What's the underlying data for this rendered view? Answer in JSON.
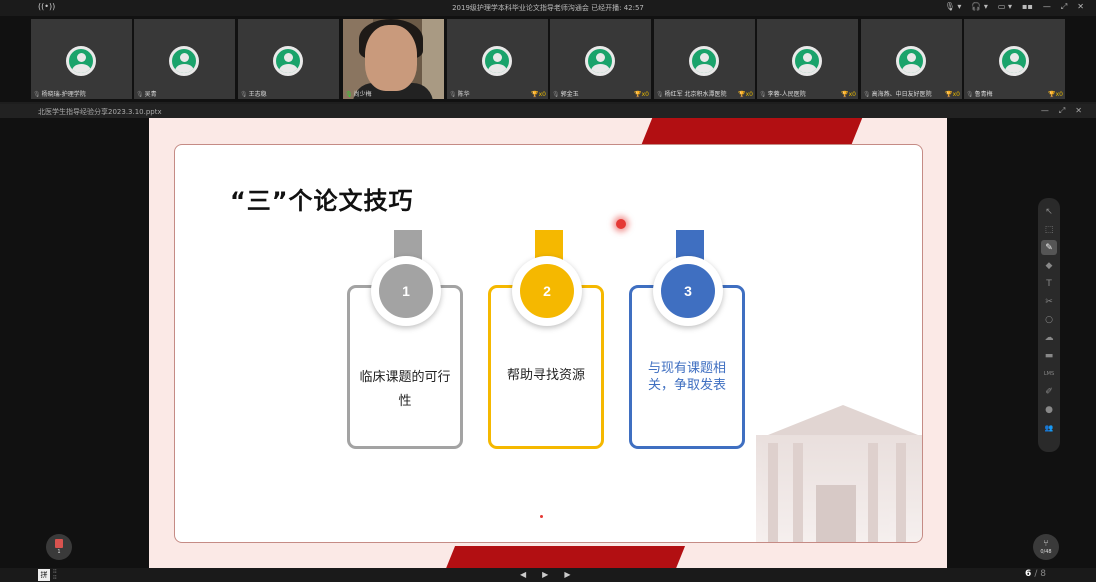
{
  "topbar": {
    "live_icon": "((•))",
    "title": "2019级护理学本科毕业论文指导老师沟通会   已经开播: 42:57",
    "controls": [
      "🎙 ▾",
      "🎧 ▾",
      "▭ ▾",
      "▪▪",
      "—",
      "⤢",
      "✕"
    ]
  },
  "participants": [
    {
      "name": "杨晓瑞-护理学院",
      "trophy": ""
    },
    {
      "name": "吴青",
      "trophy": ""
    },
    {
      "name": "王志稳",
      "trophy": ""
    },
    {
      "name": "尚少梅",
      "trophy": "",
      "video": true
    },
    {
      "name": "陈华",
      "trophy": "🏆x0"
    },
    {
      "name": "郭金玉",
      "trophy": "🏆x0"
    },
    {
      "name": "杨红军 北京积水潭医院",
      "trophy": "🏆x0"
    },
    {
      "name": "李蓉-人民医院",
      "trophy": "🏆x0"
    },
    {
      "name": "高海燕、中日友好医院",
      "trophy": "🏆x0"
    },
    {
      "name": "鲁青梅",
      "trophy": "🏆x0"
    }
  ],
  "filebar": {
    "file_name": "北医学生指导经验分享2023.3.10.pptx",
    "controls": [
      "—",
      "⤢",
      "✕"
    ]
  },
  "slide": {
    "title": "“三”个论文技巧",
    "tips": [
      {
        "number": "1",
        "text": "临床课题的可行性"
      },
      {
        "number": "2",
        "text": "帮助寻找资源"
      },
      {
        "number": "3",
        "text": "与现有课题相关，争取发表"
      }
    ]
  },
  "toolbar": {
    "tools": [
      {
        "name": "pointer-icon",
        "glyph": "↖"
      },
      {
        "name": "select-icon",
        "glyph": "⬚"
      },
      {
        "name": "pen-icon",
        "glyph": "✎",
        "active": true
      },
      {
        "name": "eraser-icon",
        "glyph": "◆"
      },
      {
        "name": "text-icon",
        "glyph": "T"
      },
      {
        "name": "scissors-icon",
        "glyph": "✂"
      },
      {
        "name": "shape-icon",
        "glyph": "○"
      },
      {
        "name": "cloud-icon",
        "glyph": "☁"
      },
      {
        "name": "box-icon",
        "glyph": "▬"
      },
      {
        "name": "lms-icon",
        "glyph": "LMS"
      },
      {
        "name": "edit-icon",
        "glyph": "✐"
      },
      {
        "name": "chat-icon",
        "glyph": "●"
      },
      {
        "name": "users-icon",
        "glyph": "👥"
      }
    ]
  },
  "left_badge": {
    "num": "1"
  },
  "right_badge": {
    "num": "0/48"
  },
  "bottombar": {
    "ime_label": "拼",
    "nav": {
      "prev": "◀",
      "play": "▶",
      "next": "▶"
    },
    "page_current": "6",
    "page_total": "/ 8"
  }
}
